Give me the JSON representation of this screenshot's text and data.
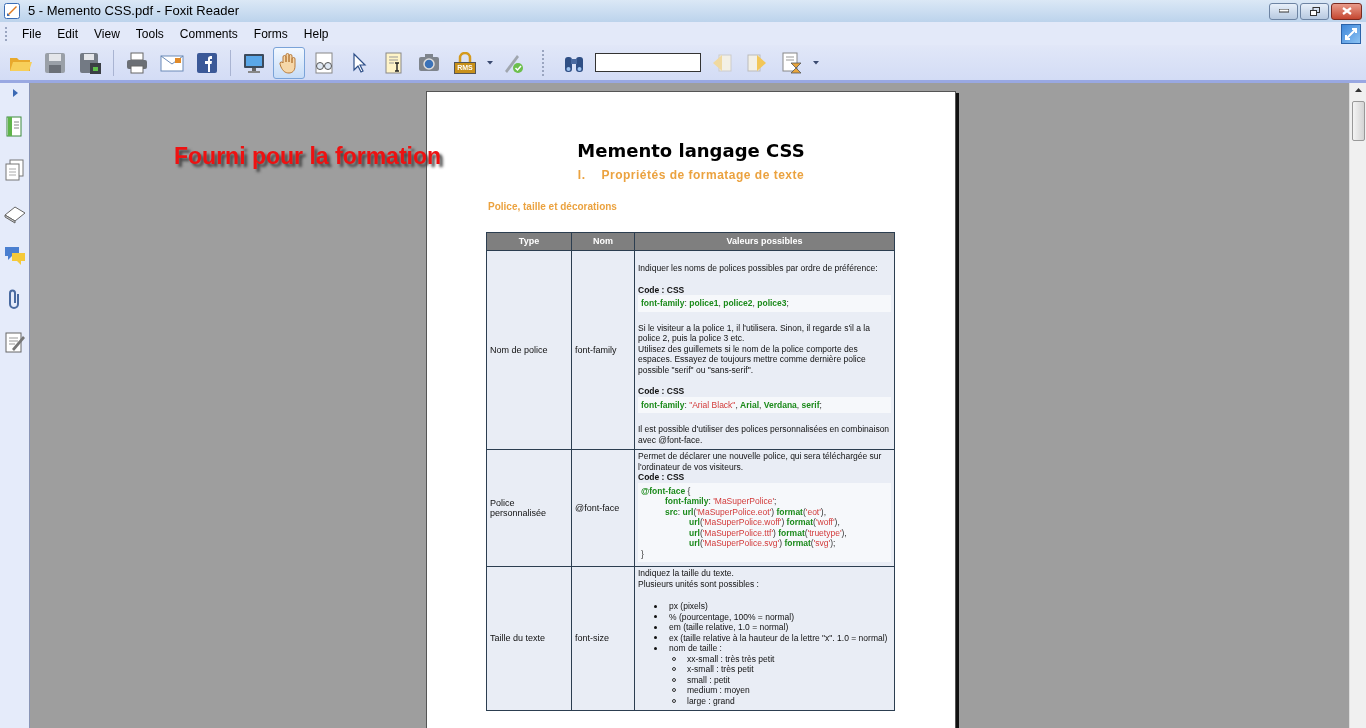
{
  "window": {
    "title": "5 - Memento CSS.pdf - Foxit Reader"
  },
  "menu": [
    "File",
    "Edit",
    "View",
    "Tools",
    "Comments",
    "Forms",
    "Help"
  ],
  "toolbar": [
    {
      "kind": "open",
      "selected": false
    },
    {
      "kind": "save",
      "selected": false
    },
    {
      "kind": "saveas",
      "selected": false
    },
    {
      "kind": "sep",
      "selected": false
    },
    {
      "kind": "print",
      "selected": false
    },
    {
      "kind": "email",
      "selected": false
    },
    {
      "kind": "facebook",
      "selected": false
    },
    {
      "kind": "sep",
      "selected": false
    },
    {
      "kind": "monitor",
      "selected": false
    },
    {
      "kind": "hand",
      "selected": true
    },
    {
      "kind": "glasses",
      "selected": false
    },
    {
      "kind": "pointer",
      "selected": false
    },
    {
      "kind": "textselect",
      "selected": false
    },
    {
      "kind": "camera",
      "selected": false
    },
    {
      "kind": "lock",
      "label": "RMS",
      "selected": false
    },
    {
      "kind": "dropdown",
      "selected": false
    },
    {
      "kind": "pen",
      "selected": false
    },
    {
      "kind": "grip",
      "selected": false
    },
    {
      "kind": "binoculars",
      "selected": false
    },
    {
      "kind": "search",
      "selected": false
    },
    {
      "kind": "prev",
      "selected": false
    },
    {
      "kind": "next",
      "selected": false
    },
    {
      "kind": "hourglass",
      "selected": false
    },
    {
      "kind": "dropdown",
      "selected": false
    }
  ],
  "sidebar": [
    {
      "kind": "bookmarks"
    },
    {
      "kind": "pages"
    },
    {
      "kind": "layers"
    },
    {
      "kind": "comments"
    },
    {
      "kind": "attachments"
    },
    {
      "kind": "signatures"
    }
  ],
  "overlay_note": "Fourni pour la formation",
  "document": {
    "title": "Memento langage CSS",
    "section_number": "I.",
    "section_title": "Propriétés de formatage de texte",
    "subsection": "Police, taille et décorations",
    "table": {
      "columns": [
        "Type",
        "Nom",
        "Valeurs possibles"
      ],
      "rows": [
        {
          "type": "Nom de police",
          "name": "font-family",
          "values": [
            {
              "kind": "para",
              "text": "Indiquer les noms de polices possibles par ordre de préférence:",
              "bold": false
            },
            {
              "kind": "para",
              "text": "Code : CSS",
              "bold": true
            },
            {
              "kind": "code",
              "lines": [
                {
                  "tokens": [
                    {
                      "text": "font-family",
                      "kind": "keyword"
                    },
                    {
                      "text": ": ",
                      "kind": "plain"
                    },
                    {
                      "text": "police1",
                      "kind": "keyword"
                    },
                    {
                      "text": ", ",
                      "kind": "plain"
                    },
                    {
                      "text": "police2",
                      "kind": "keyword"
                    },
                    {
                      "text": ", ",
                      "kind": "plain"
                    },
                    {
                      "text": "police3",
                      "kind": "keyword"
                    },
                    {
                      "text": ";",
                      "kind": "plain"
                    }
                  ]
                }
              ]
            },
            {
              "kind": "para",
              "text": "Si le visiteur a la police 1, il l'utilisera. Sinon, il regarde s'il a la police 2, puis la police 3 etc.",
              "bold": false
            },
            {
              "kind": "line",
              "text": "Utilisez des guillemets si le nom de la police comporte des espaces. Essayez de toujours mettre comme dernière police possible \"serif\" ou \"sans-serif\".",
              "bold": false
            },
            {
              "kind": "para",
              "text": "Code : CSS",
              "bold": true
            },
            {
              "kind": "code",
              "lines": [
                {
                  "tokens": [
                    {
                      "text": "font-family",
                      "kind": "keyword"
                    },
                    {
                      "text": ": ",
                      "kind": "plain"
                    },
                    {
                      "text": "\"Arial Black\"",
                      "kind": "string"
                    },
                    {
                      "text": ", ",
                      "kind": "plain"
                    },
                    {
                      "text": "Arial",
                      "kind": "keyword"
                    },
                    {
                      "text": ", ",
                      "kind": "plain"
                    },
                    {
                      "text": "Verdana",
                      "kind": "keyword"
                    },
                    {
                      "text": ", ",
                      "kind": "plain"
                    },
                    {
                      "text": "serif",
                      "kind": "keyword"
                    },
                    {
                      "text": ";",
                      "kind": "plain"
                    }
                  ]
                }
              ]
            },
            {
              "kind": "para",
              "text": "Il est possible d'utiliser des polices personnalisées en combinaison avec @font-face.",
              "bold": false
            }
          ]
        },
        {
          "type": "Police personnalisée",
          "name": "@font-face",
          "values": [
            {
              "kind": "line",
              "text": "Permet de déclarer une nouvelle police, qui sera téléchargée sur l'ordinateur de vos visiteurs.",
              "bold": false
            },
            {
              "kind": "line",
              "text": "Code : CSS",
              "bold": true
            },
            {
              "kind": "code",
              "lines": [
                {
                  "tokens": [
                    {
                      "text": "@font-face",
                      "kind": "keyword"
                    },
                    {
                      "text": " {",
                      "kind": "plain"
                    }
                  ],
                  "children": [
                    {
                      "tokens": [
                        {
                          "text": "font-family",
                          "kind": "keyword"
                        },
                        {
                          "text": ": ",
                          "kind": "plain"
                        },
                        {
                          "text": "'MaSuperPolice'",
                          "kind": "string"
                        },
                        {
                          "text": ";",
                          "kind": "plain"
                        }
                      ]
                    },
                    {
                      "tokens": [
                        {
                          "text": "src",
                          "kind": "keyword"
                        },
                        {
                          "text": ": ",
                          "kind": "plain"
                        },
                        {
                          "text": "url",
                          "kind": "keyword"
                        },
                        {
                          "text": "(",
                          "kind": "plain"
                        },
                        {
                          "text": "'MaSuperPolice.eot'",
                          "kind": "string"
                        },
                        {
                          "text": ") ",
                          "kind": "plain"
                        },
                        {
                          "text": "format",
                          "kind": "keyword"
                        },
                        {
                          "text": "(",
                          "kind": "plain"
                        },
                        {
                          "text": "'eot'",
                          "kind": "string"
                        },
                        {
                          "text": "),",
                          "kind": "plain"
                        }
                      ],
                      "children": [
                        {
                          "tokens": [
                            {
                              "text": "url",
                              "kind": "keyword"
                            },
                            {
                              "text": "(",
                              "kind": "plain"
                            },
                            {
                              "text": "'MaSuperPolice.woff'",
                              "kind": "string"
                            },
                            {
                              "text": ") ",
                              "kind": "plain"
                            },
                            {
                              "text": "format",
                              "kind": "keyword"
                            },
                            {
                              "text": "(",
                              "kind": "plain"
                            },
                            {
                              "text": "'woff'",
                              "kind": "string"
                            },
                            {
                              "text": "),",
                              "kind": "plain"
                            }
                          ]
                        },
                        {
                          "tokens": [
                            {
                              "text": "url",
                              "kind": "keyword"
                            },
                            {
                              "text": "(",
                              "kind": "plain"
                            },
                            {
                              "text": "'MaSuperPolice.ttf'",
                              "kind": "string"
                            },
                            {
                              "text": ") ",
                              "kind": "plain"
                            },
                            {
                              "text": "format",
                              "kind": "keyword"
                            },
                            {
                              "text": "(",
                              "kind": "plain"
                            },
                            {
                              "text": "'truetype'",
                              "kind": "string"
                            },
                            {
                              "text": "),",
                              "kind": "plain"
                            }
                          ]
                        },
                        {
                          "tokens": [
                            {
                              "text": "url",
                              "kind": "keyword"
                            },
                            {
                              "text": "(",
                              "kind": "plain"
                            },
                            {
                              "text": "'MaSuperPolice.svg'",
                              "kind": "string"
                            },
                            {
                              "text": ") ",
                              "kind": "plain"
                            },
                            {
                              "text": "format",
                              "kind": "keyword"
                            },
                            {
                              "text": "(",
                              "kind": "plain"
                            },
                            {
                              "text": "'svg'",
                              "kind": "string"
                            },
                            {
                              "text": ");",
                              "kind": "plain"
                            }
                          ]
                        }
                      ]
                    }
                  ]
                },
                {
                  "tokens": [
                    {
                      "text": "}",
                      "kind": "plain"
                    }
                  ]
                }
              ]
            }
          ]
        },
        {
          "type": "Taille du texte",
          "name": "font-size",
          "values": [
            {
              "kind": "line",
              "text": "Indiquez la taille du texte.",
              "bold": false
            },
            {
              "kind": "line",
              "text": "Plusieurs unités sont possibles :",
              "bold": false
            },
            {
              "kind": "list",
              "items": [
                {
                  "text": "px (pixels)"
                },
                {
                  "text": "% (pourcentage, 100% = normal)"
                },
                {
                  "text": "em (taille relative, 1.0 = normal)"
                },
                {
                  "text": "ex (taille relative à la hauteur de la lettre \"x\". 1.0 = normal)"
                },
                {
                  "text": "nom de taille :",
                  "children": [
                    {
                      "text": "xx-small : très très petit"
                    },
                    {
                      "text": "x-small : très petit"
                    },
                    {
                      "text": "small : petit"
                    },
                    {
                      "text": "medium : moyen"
                    },
                    {
                      "text": "large : grand"
                    }
                  ]
                }
              ]
            }
          ]
        }
      ]
    }
  }
}
